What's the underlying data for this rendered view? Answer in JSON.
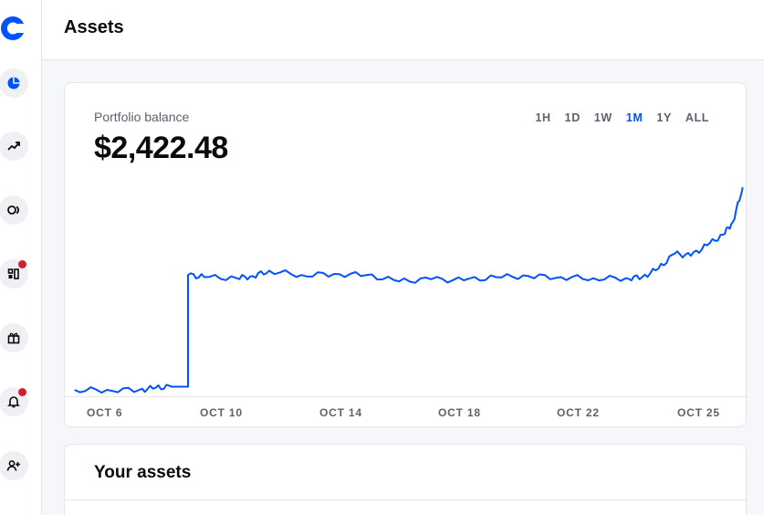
{
  "header": {
    "title": "Assets"
  },
  "sidebar": {
    "items": [
      {
        "icon": "pie-chart-icon",
        "active": true
      },
      {
        "icon": "trend-icon",
        "active": false
      },
      {
        "icon": "coins-icon",
        "active": false
      },
      {
        "icon": "dashboard-icon",
        "active": false,
        "badge": true
      },
      {
        "icon": "gift-icon",
        "active": false
      },
      {
        "icon": "bell-icon",
        "active": false,
        "badge": true
      },
      {
        "icon": "add-user-icon",
        "active": false
      }
    ]
  },
  "portfolio": {
    "label": "Portfolio balance",
    "balance": "$2,422.48",
    "ranges": [
      "1H",
      "1D",
      "1W",
      "1M",
      "1Y",
      "ALL"
    ],
    "active_range": "1M"
  },
  "chart_data": {
    "type": "line",
    "series": [
      {
        "color": "#0052ff",
        "x": [
          "Oct 5",
          "Oct 6",
          "Oct 7",
          "Oct 7.5",
          "Oct 8",
          "Oct 8.5",
          "Oct 9",
          "Oct 10",
          "Oct 10.5",
          "Oct 11",
          "Oct 12",
          "Oct 13",
          "Oct 14",
          "Oct 15",
          "Oct 16",
          "Oct 17",
          "Oct 18",
          "Oct 19",
          "Oct 20",
          "Oct 21",
          "Oct 22",
          "Oct 22.5",
          "Oct 23",
          "Oct 23.5",
          "Oct 24",
          "Oct 24.5",
          "Oct 25",
          "Oct 25.3",
          "Oct 25.6"
        ],
        "values": [
          1470,
          1470,
          1470,
          1480,
          1485,
          2010,
          2000,
          1995,
          2005,
          2030,
          2010,
          2015,
          2010,
          1980,
          1990,
          1985,
          2000,
          2005,
          2000,
          1995,
          1995,
          2000,
          2040,
          2110,
          2100,
          2150,
          2200,
          2260,
          2422
        ]
      }
    ],
    "x_ticks": [
      "OCT 6",
      "OCT 10",
      "OCT 14",
      "OCT 18",
      "OCT 22",
      "OCT 25"
    ],
    "xlabel": "",
    "ylabel": "",
    "ylim": [
      1440,
      2440
    ],
    "grid": false
  },
  "assets": {
    "title": "Your assets"
  },
  "colors": {
    "accent": "#0052ff",
    "badge": "#cf202f"
  }
}
